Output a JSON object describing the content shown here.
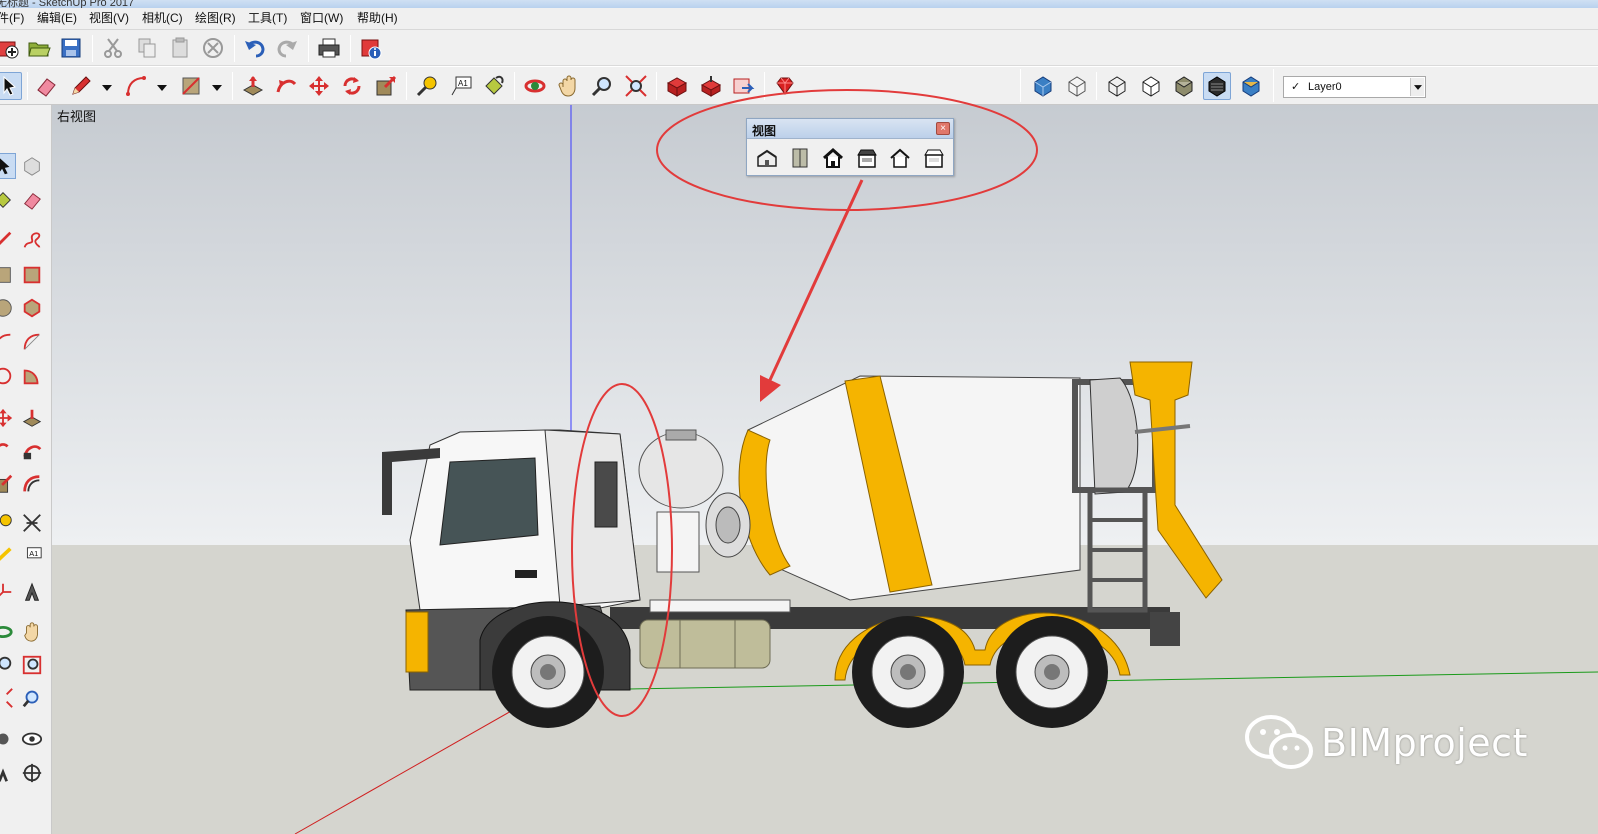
{
  "window": {
    "title_fragment": "无标题 - SketchUp Pro 2017"
  },
  "menu": [
    {
      "id": "file",
      "label": "件(F)"
    },
    {
      "id": "edit",
      "label": "编辑(E)"
    },
    {
      "id": "view",
      "label": "视图(V)"
    },
    {
      "id": "camera",
      "label": "相机(C)"
    },
    {
      "id": "draw",
      "label": "绘图(R)"
    },
    {
      "id": "tools",
      "label": "工具(T)"
    },
    {
      "id": "window",
      "label": "窗口(W)"
    },
    {
      "id": "help",
      "label": "帮助(H)"
    }
  ],
  "layer": {
    "checkmark": "✓",
    "current": "Layer0"
  },
  "viewport": {
    "view_label": "右视图"
  },
  "views_toolbar": {
    "title": "视图",
    "close": "×",
    "buttons": [
      "iso-view",
      "top-view",
      "front-view",
      "right-view",
      "back-view",
      "left-view"
    ]
  },
  "watermark": {
    "text": "BIMproject"
  },
  "colors": {
    "annotation_red": "#e23b3b",
    "truck_yellow": "#f5b400",
    "axis_blue": "#3a3aff",
    "axis_red": "#d02020",
    "axis_green": "#1a9a1a"
  }
}
